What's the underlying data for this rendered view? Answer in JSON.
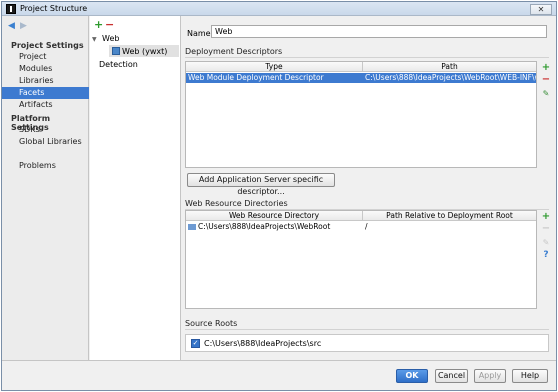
{
  "window": {
    "title": "Project Structure",
    "close_glyph": "✕"
  },
  "nav": {
    "project_settings_header": "Project Settings",
    "project_settings_items": [
      "Project",
      "Modules",
      "Libraries",
      "Facets",
      "Artifacts"
    ],
    "platform_settings_header": "Platform Settings",
    "platform_settings_items": [
      "SDKs",
      "Global Libraries"
    ],
    "other_items": [
      "Problems"
    ],
    "selected": "Facets"
  },
  "tree": {
    "add_glyph": "+",
    "remove_glyph": "−",
    "root_label": "Web",
    "child_label": "Web (ywxt)",
    "detection_label": "Detection"
  },
  "facet": {
    "name_label": "Name:",
    "name_value": "Web",
    "deployment_descriptors": {
      "section_label": "Deployment Descriptors",
      "columns": [
        "Type",
        "Path"
      ],
      "rows": [
        {
          "type": "Web Module Deployment Descriptor",
          "path": "C:\\Users\\888\\IdeaProjects\\WebRoot\\WEB-INF\\web.xml"
        }
      ],
      "add_server_button": "Add Application Server specific descriptor..."
    },
    "web_resource_directories": {
      "section_label": "Web Resource Directories",
      "columns": [
        "Web Resource Directory",
        "Path Relative to Deployment Root"
      ],
      "rows": [
        {
          "directory": "C:\\Users\\888\\IdeaProjects\\WebRoot",
          "relative": "/"
        }
      ]
    },
    "source_roots": {
      "section_label": "Source Roots",
      "checked": true,
      "path": "C:\\Users\\888\\IdeaProjects\\src"
    }
  },
  "side_tools": {
    "plus": "+",
    "minus": "−",
    "edit": "✎",
    "help": "?"
  },
  "footer": {
    "ok": "OK",
    "cancel": "Cancel",
    "apply": "Apply",
    "help": "Help"
  },
  "colors": {
    "selection": "#3d7ad0",
    "add_green": "#2e9a2e",
    "remove_red": "#c93030",
    "primary_button": "#2f6fc8"
  }
}
